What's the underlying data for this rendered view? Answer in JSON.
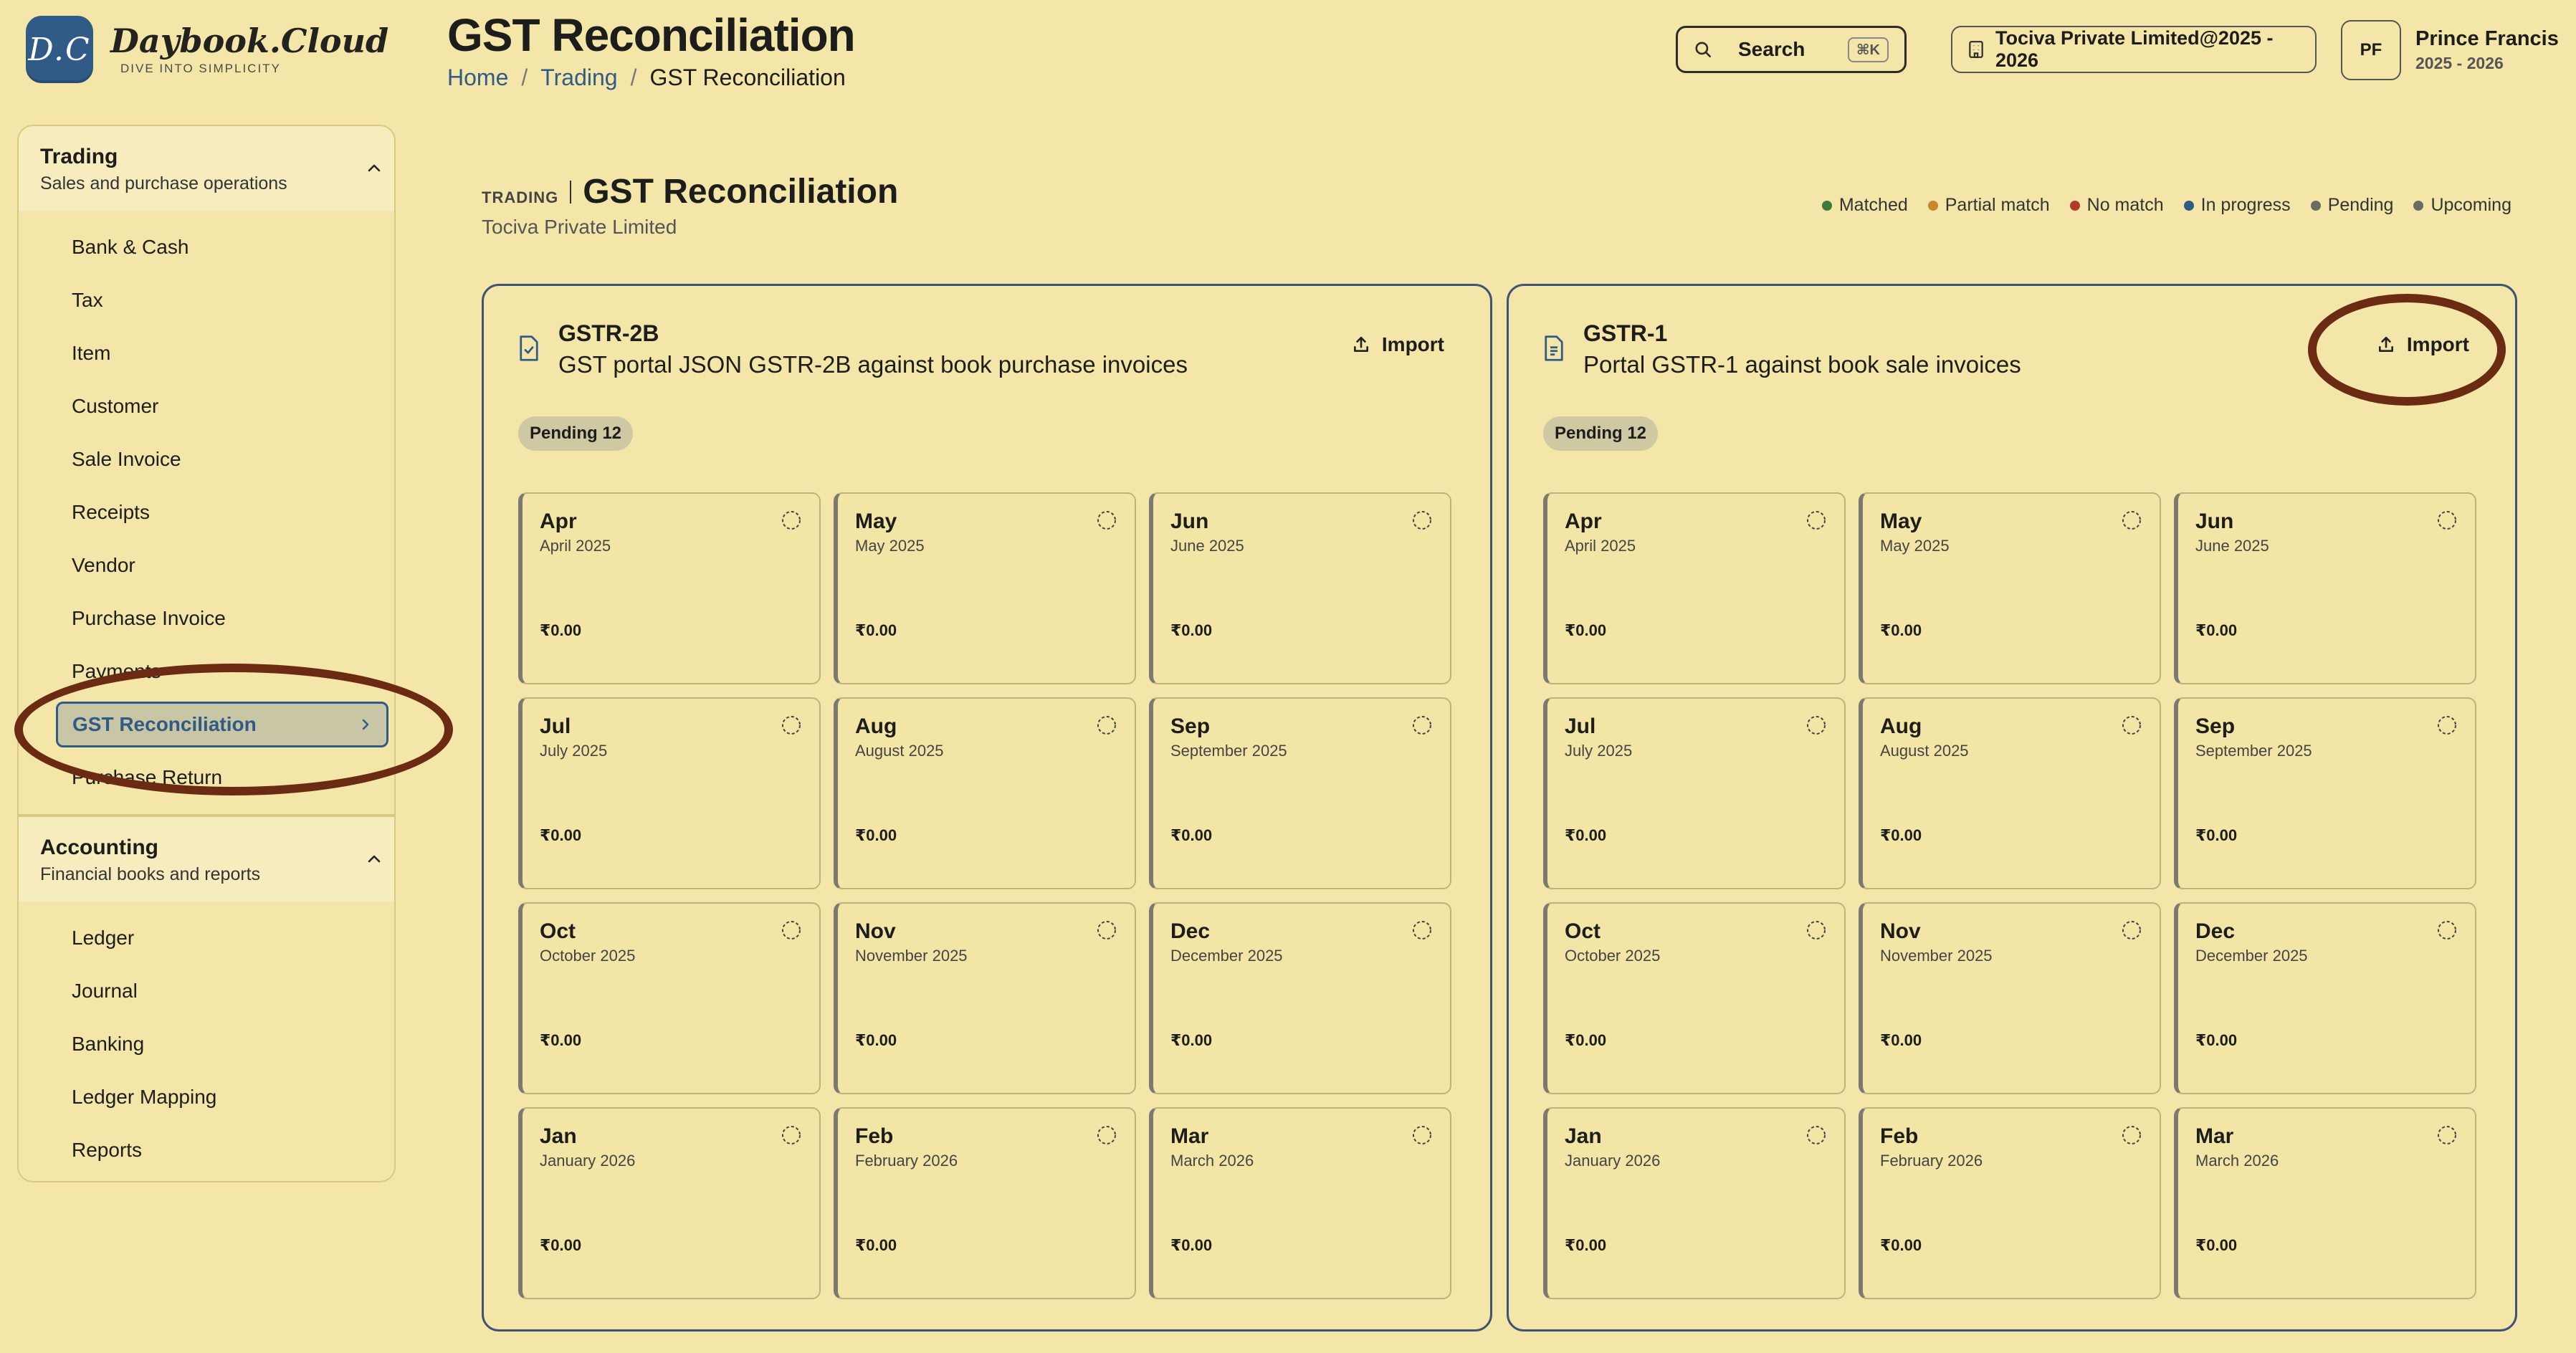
{
  "logo": {
    "mark": "D.C",
    "name": "Daybook.Cloud",
    "tagline": "DIVE INTO SIMPLICITY"
  },
  "header": {
    "title": "GST Reconciliation",
    "breadcrumb": {
      "home": "Home",
      "section": "Trading",
      "current": "GST Reconciliation",
      "separator": "/"
    },
    "search": {
      "label": "Search",
      "shortcut": "⌘K"
    },
    "company": "Tociva Private Limited@2025 - 2026",
    "user": {
      "initials": "PF",
      "name": "Prince Francis",
      "period": "2025 - 2026"
    }
  },
  "sidebar": {
    "trading": {
      "title": "Trading",
      "subtitle": "Sales and purchase operations",
      "items": [
        "Bank & Cash",
        "Tax",
        "Item",
        "Customer",
        "Sale Invoice",
        "Receipts",
        "Vendor",
        "Purchase Invoice",
        "Payments",
        "GST Reconciliation",
        "Purchase Return"
      ],
      "active": "GST Reconciliation"
    },
    "accounting": {
      "title": "Accounting",
      "subtitle": "Financial books and reports",
      "items": [
        "Ledger",
        "Journal",
        "Banking",
        "Ledger Mapping",
        "Reports"
      ]
    }
  },
  "content": {
    "section_label": "TRADING",
    "title": "GST Reconciliation",
    "company": "Tociva Private Limited",
    "legend": [
      {
        "label": "Matched",
        "color": "#3f7a3a"
      },
      {
        "label": "Partial match",
        "color": "#c9862c"
      },
      {
        "label": "No match",
        "color": "#b33a2a"
      },
      {
        "label": "In progress",
        "color": "#2f5b86"
      },
      {
        "label": "Pending",
        "color": "#6b6b62"
      },
      {
        "label": "Upcoming",
        "color": "#6b6b62"
      }
    ]
  },
  "panels": {
    "gstr2b": {
      "title": "GSTR-2B",
      "subtitle": "GST portal JSON GSTR-2B against book purchase invoices",
      "import_label": "Import",
      "badge": "Pending 12",
      "months": [
        {
          "short": "Apr",
          "full": "April 2025",
          "amount": "₹0.00"
        },
        {
          "short": "May",
          "full": "May 2025",
          "amount": "₹0.00"
        },
        {
          "short": "Jun",
          "full": "June 2025",
          "amount": "₹0.00"
        },
        {
          "short": "Jul",
          "full": "July 2025",
          "amount": "₹0.00"
        },
        {
          "short": "Aug",
          "full": "August 2025",
          "amount": "₹0.00"
        },
        {
          "short": "Sep",
          "full": "September 2025",
          "amount": "₹0.00"
        },
        {
          "short": "Oct",
          "full": "October 2025",
          "amount": "₹0.00"
        },
        {
          "short": "Nov",
          "full": "November 2025",
          "amount": "₹0.00"
        },
        {
          "short": "Dec",
          "full": "December 2025",
          "amount": "₹0.00"
        },
        {
          "short": "Jan",
          "full": "January 2026",
          "amount": "₹0.00"
        },
        {
          "short": "Feb",
          "full": "February 2026",
          "amount": "₹0.00"
        },
        {
          "short": "Mar",
          "full": "March 2026",
          "amount": "₹0.00"
        }
      ]
    },
    "gstr1": {
      "title": "GSTR-1",
      "subtitle": "Portal GSTR-1 against book sale invoices",
      "import_label": "Import",
      "badge": "Pending 12",
      "months": [
        {
          "short": "Apr",
          "full": "April 2025",
          "amount": "₹0.00"
        },
        {
          "short": "May",
          "full": "May 2025",
          "amount": "₹0.00"
        },
        {
          "short": "Jun",
          "full": "June 2025",
          "amount": "₹0.00"
        },
        {
          "short": "Jul",
          "full": "July 2025",
          "amount": "₹0.00"
        },
        {
          "short": "Aug",
          "full": "August 2025",
          "amount": "₹0.00"
        },
        {
          "short": "Sep",
          "full": "September 2025",
          "amount": "₹0.00"
        },
        {
          "short": "Oct",
          "full": "October 2025",
          "amount": "₹0.00"
        },
        {
          "short": "Nov",
          "full": "November 2025",
          "amount": "₹0.00"
        },
        {
          "short": "Dec",
          "full": "December 2025",
          "amount": "₹0.00"
        },
        {
          "short": "Jan",
          "full": "January 2026",
          "amount": "₹0.00"
        },
        {
          "short": "Feb",
          "full": "February 2026",
          "amount": "₹0.00"
        },
        {
          "short": "Mar",
          "full": "March 2026",
          "amount": "₹0.00"
        }
      ]
    }
  },
  "colors": {
    "background": "#f4e6a8",
    "accent": "#2f5b86",
    "annotation": "#6b2a12",
    "panel_border": "#3f5373"
  }
}
